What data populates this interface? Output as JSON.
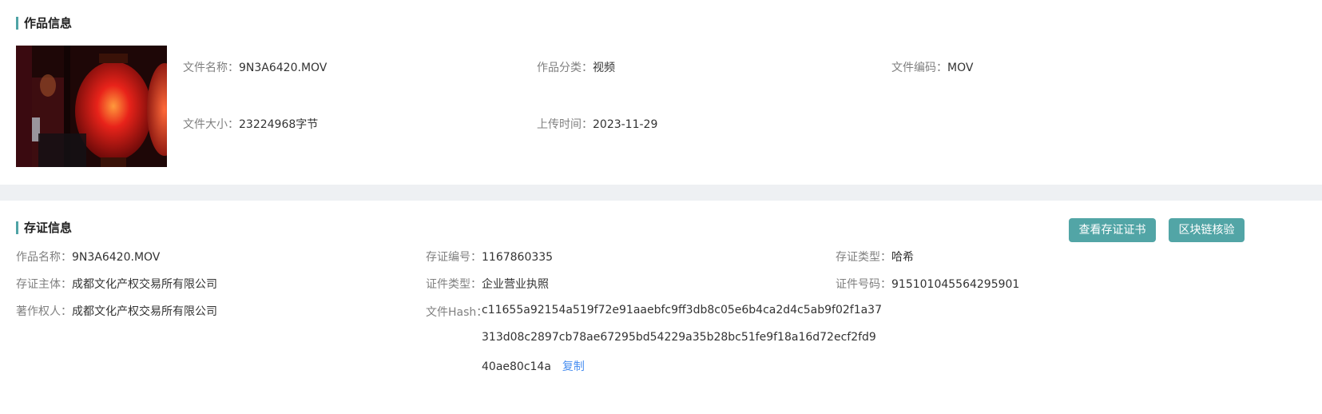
{
  "work_info": {
    "title": "作品信息",
    "thumbnail_icon": "lantern-video-thumbnail",
    "fields": {
      "file_name": {
        "label": "文件名称：",
        "value": "9N3A6420.MOV"
      },
      "category": {
        "label": "作品分类：",
        "value": "视频"
      },
      "encoding": {
        "label": "文件编码：",
        "value": "MOV"
      },
      "file_size": {
        "label": "文件大小：",
        "value": "23224968字节"
      },
      "upload_time": {
        "label": "上传时间：",
        "value": "2023-11-29"
      }
    }
  },
  "evidence_info": {
    "title": "存证信息",
    "buttons": {
      "view_certificate": "查看存证证书",
      "blockchain_verify": "区块链核验"
    },
    "fields": {
      "work_name": {
        "label": "作品名称：",
        "value": "9N3A6420.MOV"
      },
      "evidence_no": {
        "label": "存证编号：",
        "value": "1167860335"
      },
      "evidence_type": {
        "label": "存证类型：",
        "value": "哈希"
      },
      "subject": {
        "label": "存证主体：",
        "value": "成都文化产权交易所有限公司"
      },
      "cert_type": {
        "label": "证件类型：",
        "value": "企业营业执照"
      },
      "cert_no": {
        "label": "证件号码：",
        "value": "915101045564295901"
      },
      "copyright_holder": {
        "label": "著作权人：",
        "value": "成都文化产权交易所有限公司"
      }
    },
    "hash": {
      "label": "文件Hash：",
      "line1": "c11655a92154a519f72e91aaebfc9ff3db8c05e6b4ca2d4c5ab9f02f1a37",
      "line2": "313d08c2897cb78ae67295bd54229a35b28bc51fe9f18a16d72ecf2fd9",
      "line3": "40ae80c14a",
      "copy_label": "复制"
    }
  },
  "colors": {
    "accent": "#52a5a6",
    "link": "#4a8ff0",
    "separator": "#eef0f3"
  }
}
